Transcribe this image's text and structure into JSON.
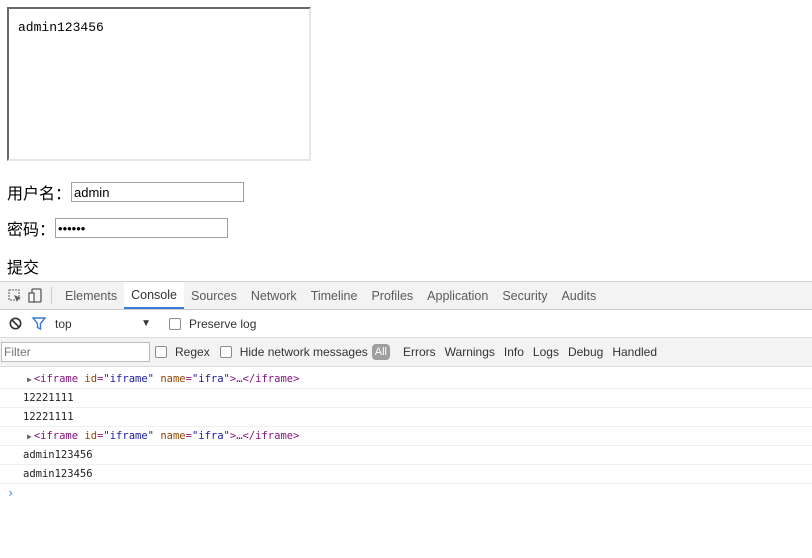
{
  "page": {
    "iframe_text": "admin123456",
    "username_label": "用户名：",
    "username_value": "admin",
    "password_label": "密码：",
    "password_value": "123456",
    "submit_label": "提交"
  },
  "devtools": {
    "tabs": [
      "Elements",
      "Console",
      "Sources",
      "Network",
      "Timeline",
      "Profiles",
      "Application",
      "Security",
      "Audits"
    ],
    "active_tab": "Console",
    "context": "top",
    "preserve_log": "Preserve log",
    "filter_placeholder": "Filter",
    "regex": "Regex",
    "hide_network": "Hide network messages",
    "levels": [
      "All",
      "Errors",
      "Warnings",
      "Info",
      "Logs",
      "Debug",
      "Handled"
    ],
    "console": [
      {
        "type": "element",
        "tag_open": "<iframe",
        "attr1": "id",
        "val1": "\"iframe\"",
        "attr2": "name",
        "val2": "\"ifra\"",
        "rest": ">…</iframe>"
      },
      {
        "type": "text",
        "text": "12221111"
      },
      {
        "type": "text",
        "text": "12221111"
      },
      {
        "type": "element",
        "tag_open": "<iframe",
        "attr1": "id",
        "val1": "\"iframe\"",
        "attr2": "name",
        "val2": "\"ifra\"",
        "rest": ">…</iframe>"
      },
      {
        "type": "text",
        "text": "admin123456"
      },
      {
        "type": "text",
        "text": "admin123456"
      }
    ],
    "prompt": "›"
  }
}
